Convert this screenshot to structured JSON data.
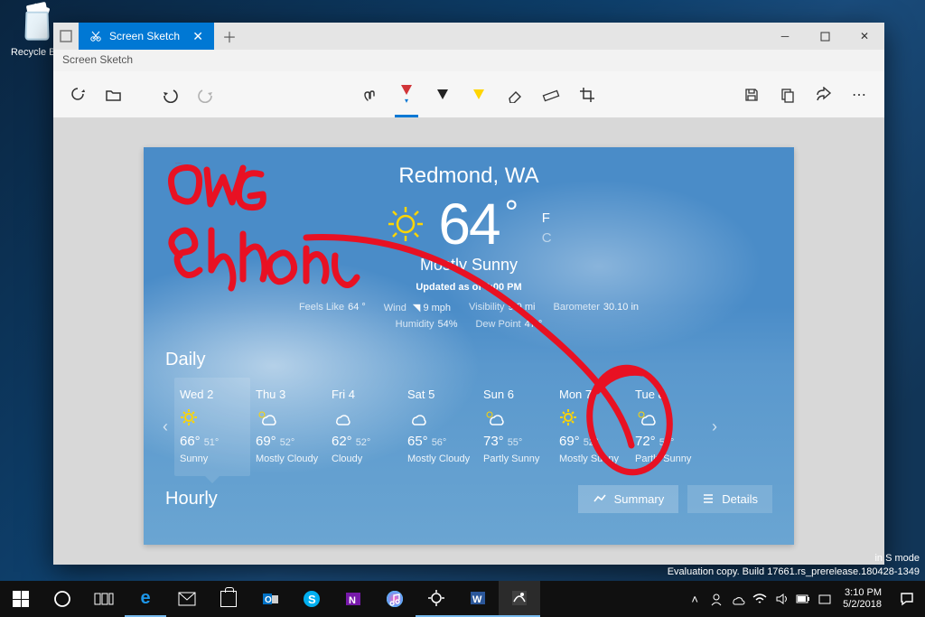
{
  "desktop": {
    "recycle_bin_label": "Recycle Bin"
  },
  "window": {
    "tab_title": "Screen Sketch",
    "subtitle": "Screen Sketch"
  },
  "weather": {
    "location": "Redmond, WA",
    "temperature": "64",
    "unit_primary": "F",
    "unit_secondary": "C",
    "condition": "Mostly Sunny",
    "updated": "Updated as of 3:00 PM",
    "stats": {
      "feels_like_label": "Feels Like",
      "feels_like": "64 °",
      "wind_label": "Wind",
      "wind": "9 mph",
      "visibility_label": "Visibility",
      "visibility": "9.9 mi",
      "barometer_label": "Barometer",
      "barometer": "30.10 in",
      "humidity_label": "Humidity",
      "humidity": "54%",
      "dew_label": "Dew Point",
      "dew": "47 °"
    },
    "daily_heading": "Daily",
    "hourly_heading": "Hourly",
    "daily": [
      {
        "name": "Wed 2",
        "hi": "66°",
        "lo": "51°",
        "cond": "Sunny"
      },
      {
        "name": "Thu 3",
        "hi": "69°",
        "lo": "52°",
        "cond": "Mostly Cloudy"
      },
      {
        "name": "Fri 4",
        "hi": "62°",
        "lo": "52°",
        "cond": "Cloudy"
      },
      {
        "name": "Sat 5",
        "hi": "65°",
        "lo": "56°",
        "cond": "Mostly Cloudy"
      },
      {
        "name": "Sun 6",
        "hi": "73°",
        "lo": "55°",
        "cond": "Partly Sunny"
      },
      {
        "name": "Mon 7",
        "hi": "69°",
        "lo": "52°",
        "cond": "Mostly Sunny"
      },
      {
        "name": "Tue 8",
        "hi": "72°",
        "lo": "54°",
        "cond": "Partly Sunny"
      }
    ],
    "summary_btn": "Summary",
    "details_btn": "Details"
  },
  "annotation_text": "OMG Sunshine!",
  "watermark": {
    "line1": "in S mode",
    "line2": "Evaluation copy. Build 17661.rs_prerelease.180428-1349"
  },
  "tray": {
    "time": "3:10 PM",
    "date": "5/2/2018"
  }
}
